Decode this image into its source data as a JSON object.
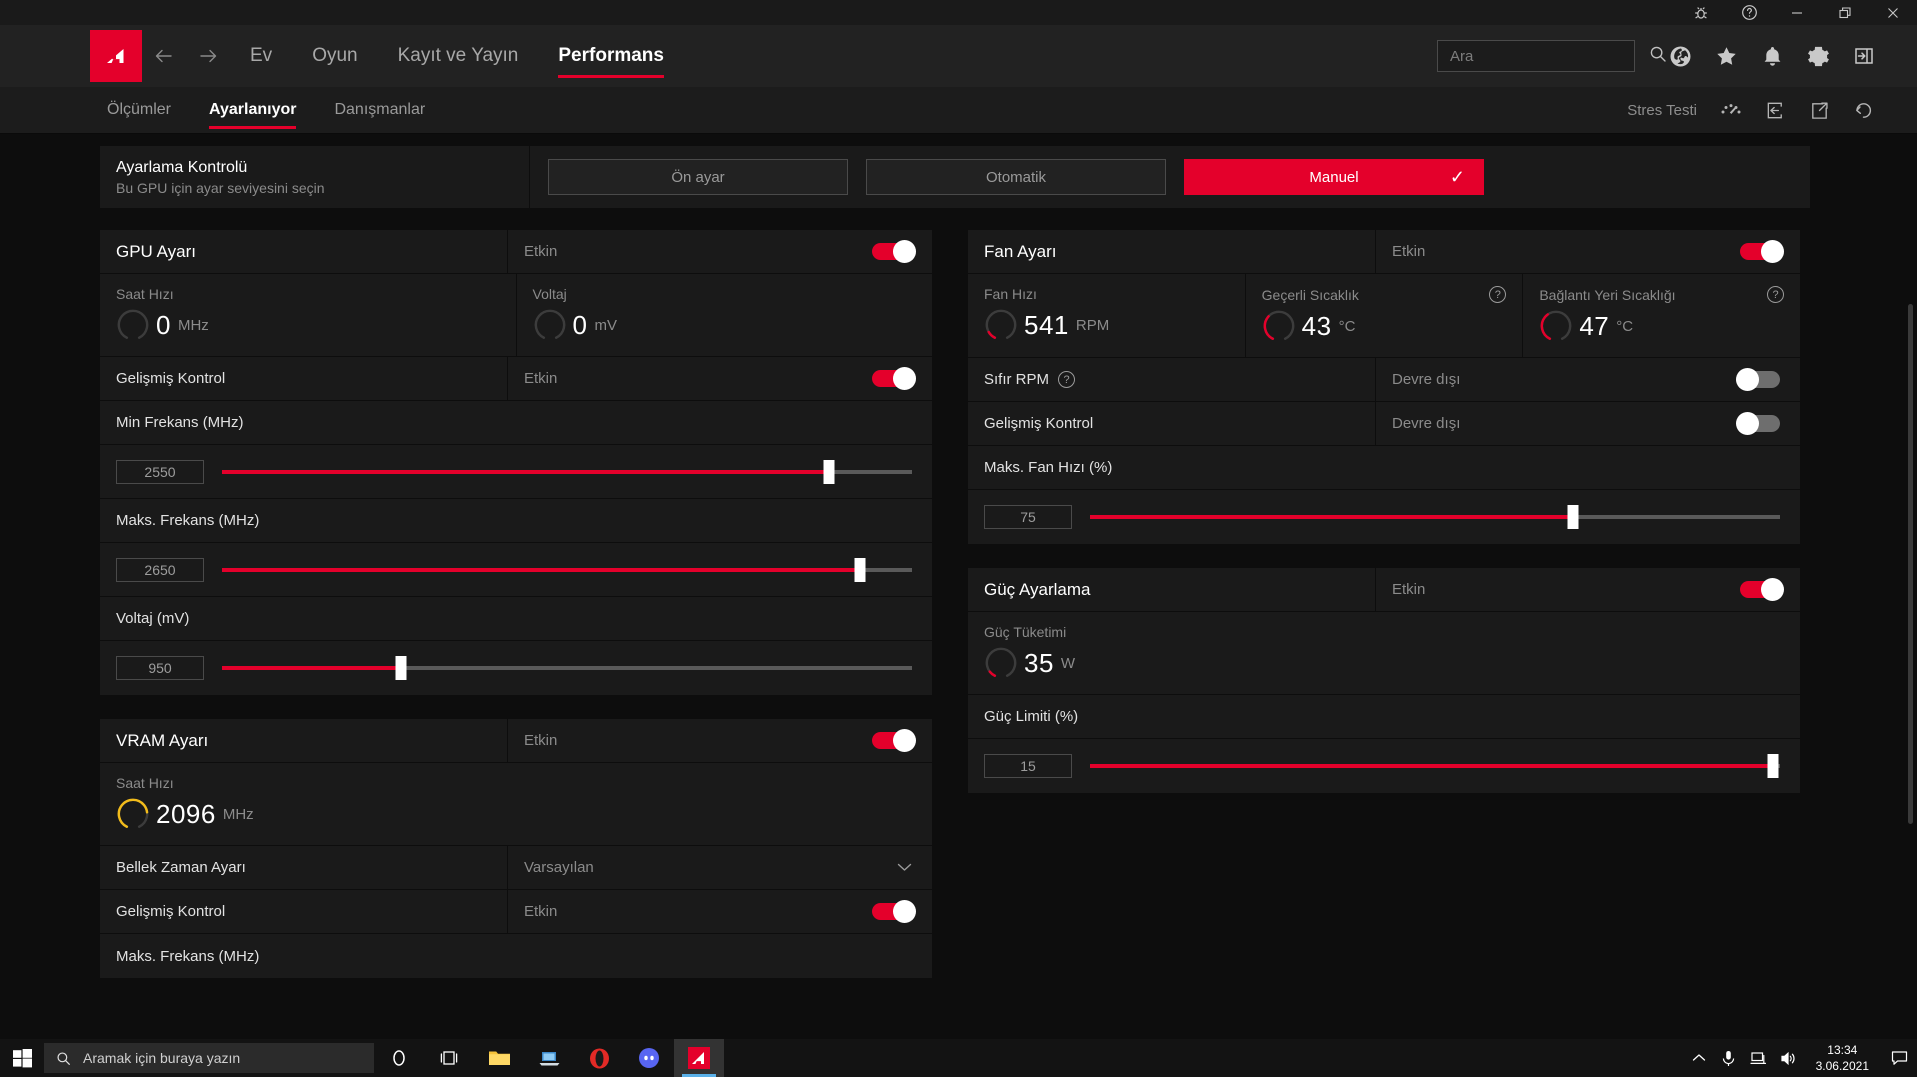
{
  "titlebar": {
    "buttons": [
      {
        "name": "bug-report-icon",
        "label": ""
      },
      {
        "name": "help-icon",
        "label": ""
      },
      {
        "name": "minimize-icon",
        "label": ""
      },
      {
        "name": "restore-icon",
        "label": ""
      },
      {
        "name": "close-icon",
        "label": ""
      }
    ]
  },
  "nav": {
    "brand": "AMD",
    "items": [
      {
        "label": "Ev",
        "active": false
      },
      {
        "label": "Oyun",
        "active": false
      },
      {
        "label": "Kayıt ve Yayın",
        "active": false
      },
      {
        "label": "Performans",
        "active": true
      }
    ],
    "search_placeholder": "Ara",
    "search_value": "",
    "icons": [
      "globe-icon",
      "star-icon",
      "bell-icon",
      "gear-icon",
      "panel-toggle-icon"
    ]
  },
  "subnav": {
    "items": [
      {
        "label": "Ölçümler",
        "active": false
      },
      {
        "label": "Ayarlanıyor",
        "active": true
      },
      {
        "label": "Danışmanlar",
        "active": false
      }
    ],
    "stress_test_label": "Stres Testi",
    "icons": [
      "stress-test-gauge-icon",
      "import-profile-icon",
      "export-profile-icon",
      "reset-icon"
    ]
  },
  "tuning_control": {
    "title": "Ayarlama Kontrolü",
    "subtitle": "Bu GPU için ayar seviyesini seçin",
    "options": [
      {
        "label": "Ön ayar",
        "selected": false
      },
      {
        "label": "Otomatik",
        "selected": false
      },
      {
        "label": "Manuel",
        "selected": true
      }
    ],
    "check_glyph": "✓"
  },
  "accent_colors": {
    "brand_red": "#e4002b",
    "gauge_red": "#e4002b",
    "gauge_amber": "#f2bc1b",
    "panel_bg": "#1a1a1a",
    "page_bg": "#0d0d0d"
  },
  "panels": {
    "gpu_tuning": {
      "title": "GPU Ayarı",
      "enabled_label": "Etkin",
      "enabled": true,
      "gauges": [
        {
          "caption": "Saat Hızı",
          "value": "0",
          "unit": "MHz",
          "fill_pct": 0,
          "color": "#e4002b",
          "help": false
        },
        {
          "caption": "Voltaj",
          "value": "0",
          "unit": "mV",
          "fill_pct": 0,
          "color": "#e4002b",
          "help": false
        }
      ],
      "advanced_row": {
        "label": "Gelişmiş Kontrol",
        "state": "Etkin",
        "enabled": true
      },
      "sliders": [
        {
          "label": "Min Frekans (MHz)",
          "value": "2550",
          "pct": 88
        },
        {
          "label": "Maks. Frekans (MHz)",
          "value": "2650",
          "pct": 92.5
        },
        {
          "label": "Voltaj (mV)",
          "value": "950",
          "pct": 26
        }
      ]
    },
    "vram_tuning": {
      "title": "VRAM Ayarı",
      "enabled_label": "Etkin",
      "enabled": true,
      "gauges": [
        {
          "caption": "Saat Hızı",
          "value": "2096",
          "unit": "MHz",
          "fill_pct": 88,
          "color": "#f2bc1b",
          "help": false
        }
      ],
      "memory_timing": {
        "label": "Bellek Zaman Ayarı",
        "value": "Varsayılan",
        "chevron": "⌄"
      },
      "advanced_row": {
        "label": "Gelişmiş Kontrol",
        "state": "Etkin",
        "enabled": true
      },
      "sliders": [
        {
          "label": "Maks. Frekans (MHz)",
          "value": "",
          "pct": 0
        }
      ]
    },
    "fan_tuning": {
      "title": "Fan Ayarı",
      "enabled_label": "Etkin",
      "enabled": true,
      "gauges": [
        {
          "caption": "Fan Hızı",
          "value": "541",
          "unit": "RPM",
          "fill_pct": 12,
          "color": "#e4002b",
          "help": false
        },
        {
          "caption": "Geçerli Sıcaklık",
          "value": "43",
          "unit": "°C",
          "fill_pct": 40,
          "color": "#e4002b",
          "help": true
        },
        {
          "caption": "Bağlantı Yeri Sıcaklığı",
          "value": "47",
          "unit": "°C",
          "fill_pct": 44,
          "color": "#e4002b",
          "help": true
        }
      ],
      "zero_rpm_row": {
        "label": "Sıfır RPM",
        "state": "Devre dışı",
        "enabled": false,
        "help": true
      },
      "advanced_row": {
        "label": "Gelişmiş Kontrol",
        "state": "Devre dışı",
        "enabled": false
      },
      "sliders": [
        {
          "label": "Maks. Fan Hızı (%)",
          "value": "75",
          "pct": 70
        }
      ]
    },
    "power_tuning": {
      "title": "Güç Ayarlama",
      "enabled_label": "Etkin",
      "enabled": true,
      "gauges": [
        {
          "caption": "Güç Tüketimi",
          "value": "35",
          "unit": "W",
          "fill_pct": 10,
          "color": "#e4002b",
          "help": false
        }
      ],
      "sliders": [
        {
          "label": "Güç Limiti (%)",
          "value": "15",
          "pct": 99
        }
      ]
    }
  },
  "taskbar": {
    "search_placeholder": "Aramak için buraya yazın",
    "apps": [
      {
        "name": "cortana-icon",
        "active": false
      },
      {
        "name": "task-view-icon",
        "active": false
      },
      {
        "name": "file-explorer-icon",
        "active": false
      },
      {
        "name": "remote-desktop-icon",
        "active": false
      },
      {
        "name": "opera-icon",
        "active": false
      },
      {
        "name": "discord-icon",
        "active": false
      },
      {
        "name": "amd-radeon-software-icon",
        "active": true
      }
    ],
    "tray_icons": [
      "show-hidden-icons",
      "microphone-icon",
      "network-icon",
      "volume-icon"
    ],
    "time": "13:34",
    "date": "3.06.2021",
    "action_center": "notification-icon"
  }
}
